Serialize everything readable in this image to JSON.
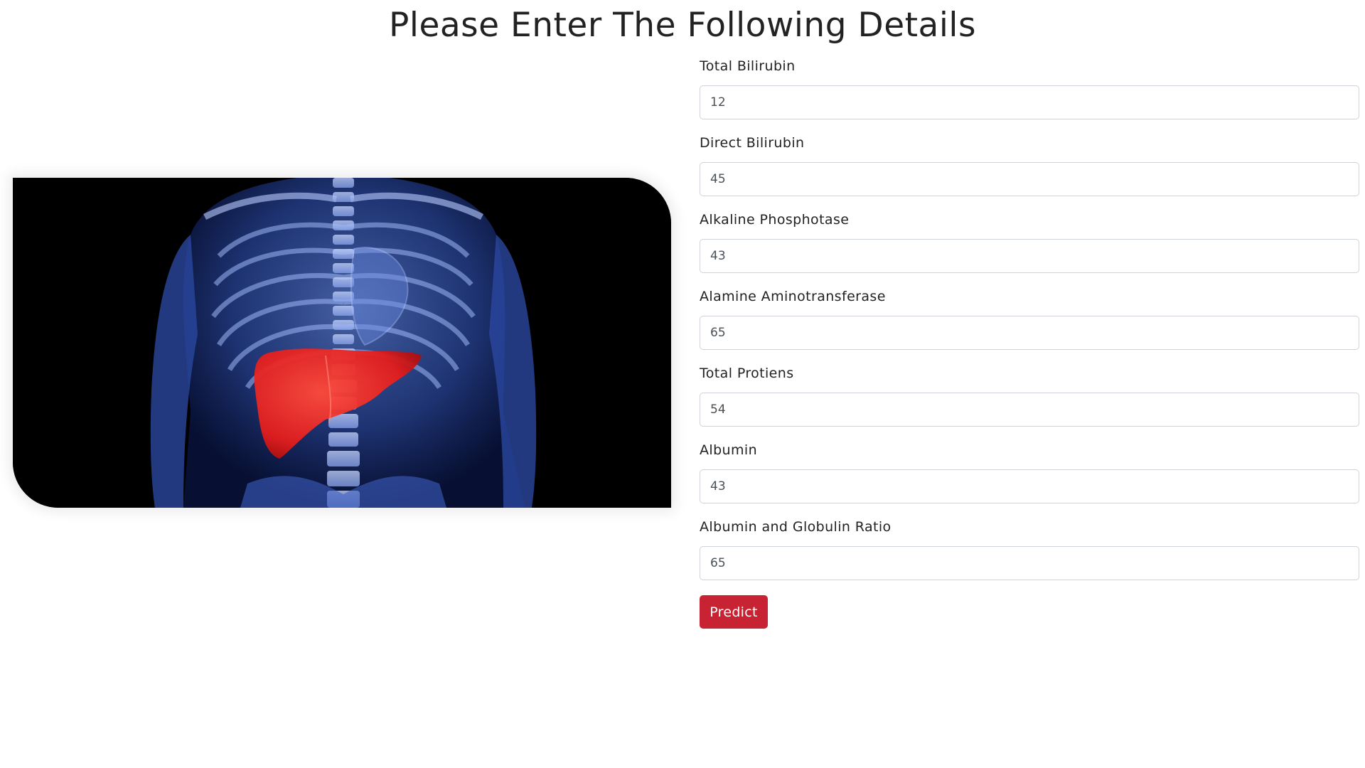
{
  "page": {
    "title": "Please Enter The Following Details"
  },
  "image": {
    "icon": "liver-xray-illustration",
    "accent_color": "#e41d1d",
    "background_color": "#000000"
  },
  "form": {
    "fields": [
      {
        "label": "Total Bilirubin",
        "value": "12"
      },
      {
        "label": "Direct Bilirubin",
        "value": "45"
      },
      {
        "label": "Alkaline Phosphotase",
        "value": "43"
      },
      {
        "label": "Alamine Aminotransferase",
        "value": "65"
      },
      {
        "label": "Total Protiens",
        "value": "54"
      },
      {
        "label": "Albumin",
        "value": "43"
      },
      {
        "label": "Albumin and Globulin Ratio",
        "value": "65"
      }
    ],
    "submit_label": "Predict",
    "submit_color": "#c82333"
  }
}
